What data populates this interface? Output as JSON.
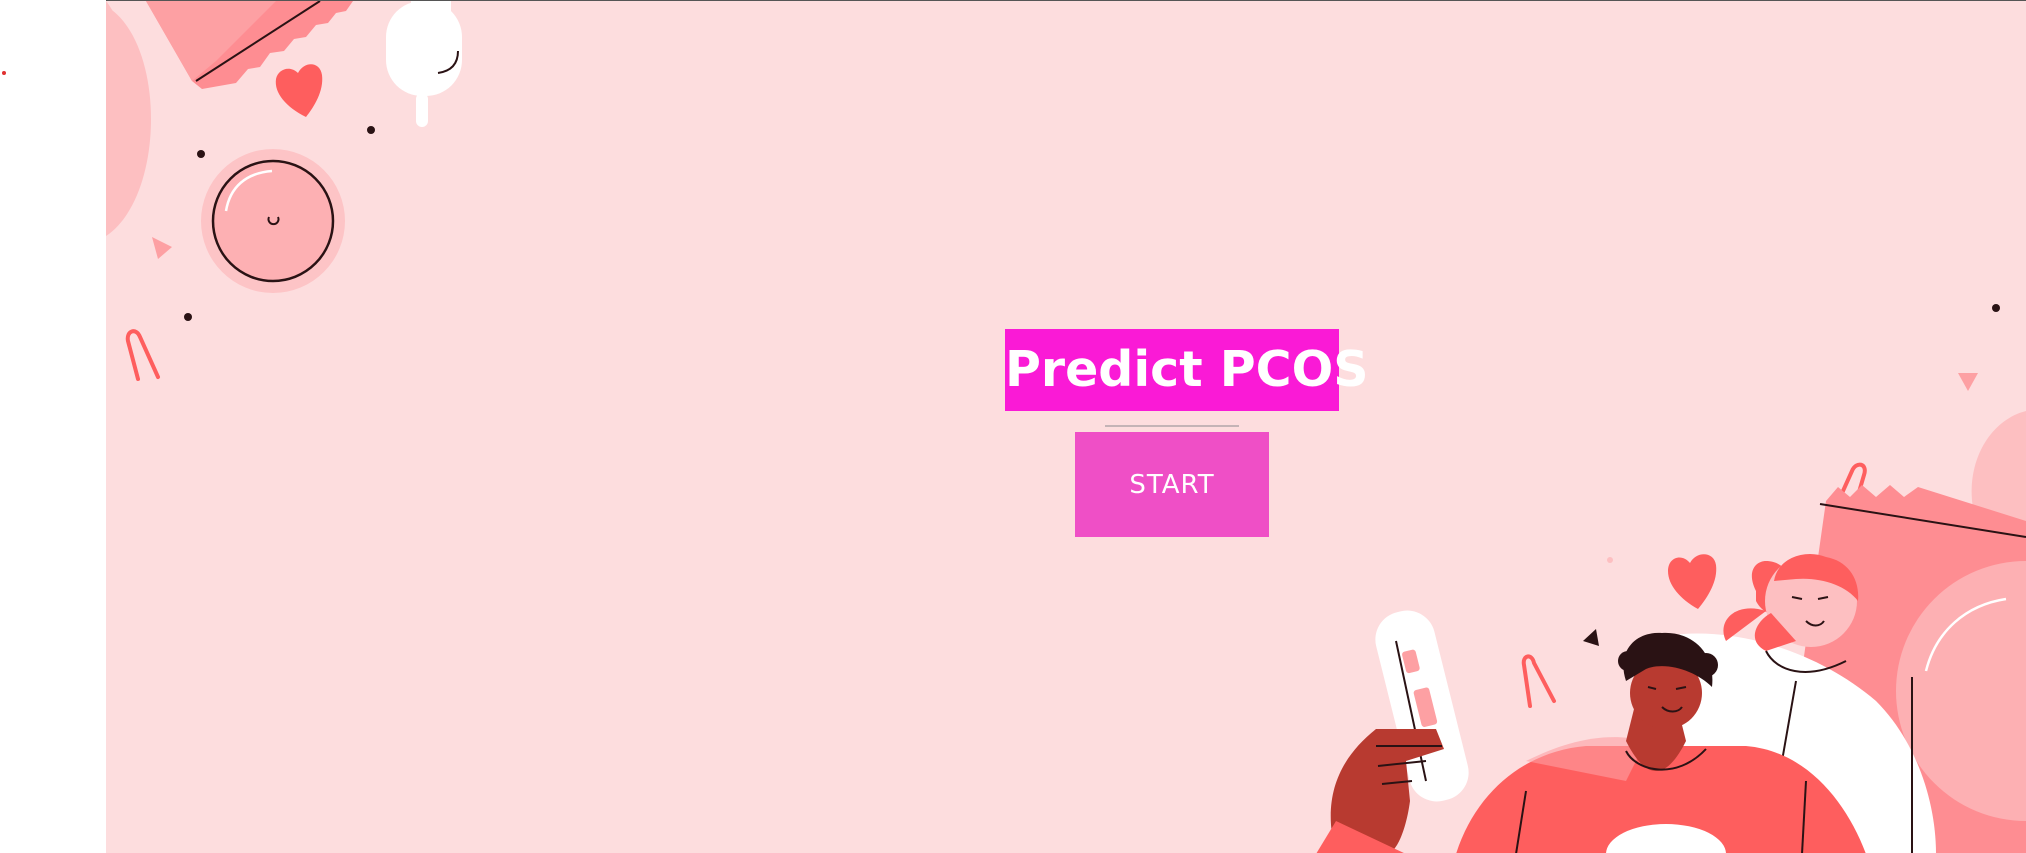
{
  "hero": {
    "title": "Predict PCOS",
    "start_label": "START"
  },
  "colors": {
    "background": "#fdddde",
    "title_background": "#fa1ad6",
    "button_background": "#ef4fc6",
    "accent_red": "#fe5e5e",
    "accent_pink": "#fd9c9e",
    "skin_dark": "#b83a30",
    "ink": "#2a1214"
  },
  "illustration": {
    "icons": [
      "condom-wrapper-icon",
      "heart-icon",
      "tampon-icon",
      "contraceptive-ring-icon",
      "awareness-ribbon-icon",
      "pregnancy-test-icon",
      "person-illustration"
    ]
  }
}
